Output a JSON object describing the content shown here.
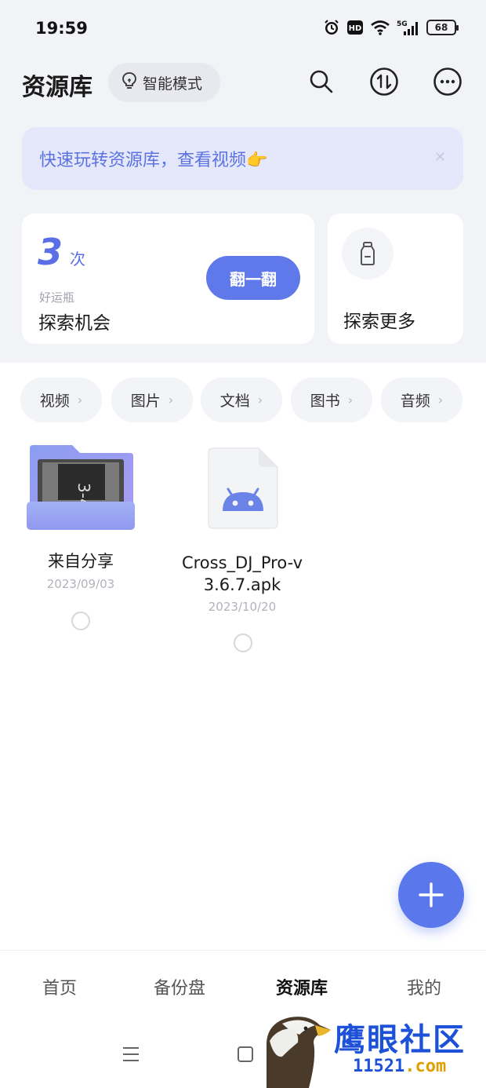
{
  "status_bar": {
    "time": "19:59",
    "network": "5G",
    "battery": "68",
    "icons": [
      "alarm-icon",
      "hd-icon",
      "wifi-icon",
      "signal-icon",
      "battery-icon"
    ]
  },
  "header": {
    "title": "资源库",
    "mode_label": "智能模式",
    "icons": [
      "bulb-icon",
      "search-icon",
      "transfer-icon",
      "more-icon"
    ]
  },
  "banner": {
    "text": "快速玩转资源库，查看视频👉"
  },
  "lucky_card": {
    "count": "3",
    "count_unit": "次",
    "subtitle": "好运瓶",
    "title": "探索机会",
    "button": "翻一翻"
  },
  "explore_card": {
    "title": "探索更多",
    "icon": "bottle-icon"
  },
  "categories": [
    {
      "label": "视频"
    },
    {
      "label": "图片"
    },
    {
      "label": "文档"
    },
    {
      "label": "图书"
    },
    {
      "label": "音频"
    }
  ],
  "files": [
    {
      "name": "来自分享",
      "date": "2023/09/03",
      "type": "folder"
    },
    {
      "name_line1": "Cross_DJ_Pro-v",
      "name_line2": "3.6.7.apk",
      "date": "2023/10/20",
      "type": "apk"
    }
  ],
  "bottom_nav": [
    {
      "label": "首页"
    },
    {
      "label": "备份盘"
    },
    {
      "label": "资源库",
      "active": true
    },
    {
      "label": "我的"
    }
  ],
  "watermark": {
    "text": "鹰眼社区",
    "url_prefix": "11521",
    "url_suffix": ".com"
  },
  "colors": {
    "accent": "#5a78ec",
    "banner_bg": "#e5e8fb",
    "page_bg": "#f2f3f7"
  }
}
